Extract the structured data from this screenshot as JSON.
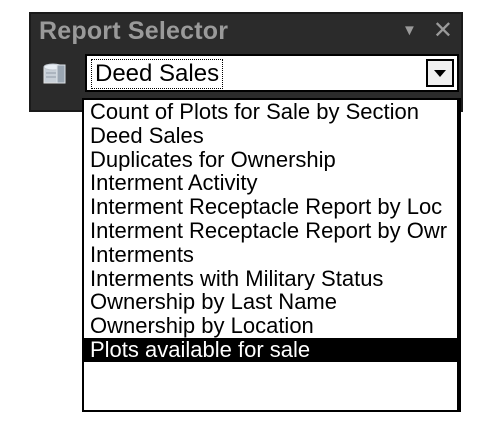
{
  "panel": {
    "title": "Report Selector",
    "pin_icon": "dropdown-triangle-icon",
    "close_glyph": "✕"
  },
  "combo": {
    "selected_value": "Deed Sales",
    "icon": "database-icon",
    "button_icon": "chevron-down-icon"
  },
  "dropdown": {
    "options": [
      "Count of Plots for Sale by Section",
      "Deed Sales",
      "Duplicates for Ownership",
      "Interment Activity",
      "Interment Receptacle Report by Loc",
      "Interment Receptacle Report by Owr",
      "Interments",
      "Interments with Military Status",
      "Ownership by Last Name",
      "Ownership by Location",
      "Plots available for sale"
    ],
    "highlighted_option": "Plots available for sale"
  },
  "colors": {
    "panel_bg": "#2b2b2b",
    "title_text": "#9a9a9a",
    "highlight_bg": "#000000",
    "highlight_text": "#ffffff"
  }
}
